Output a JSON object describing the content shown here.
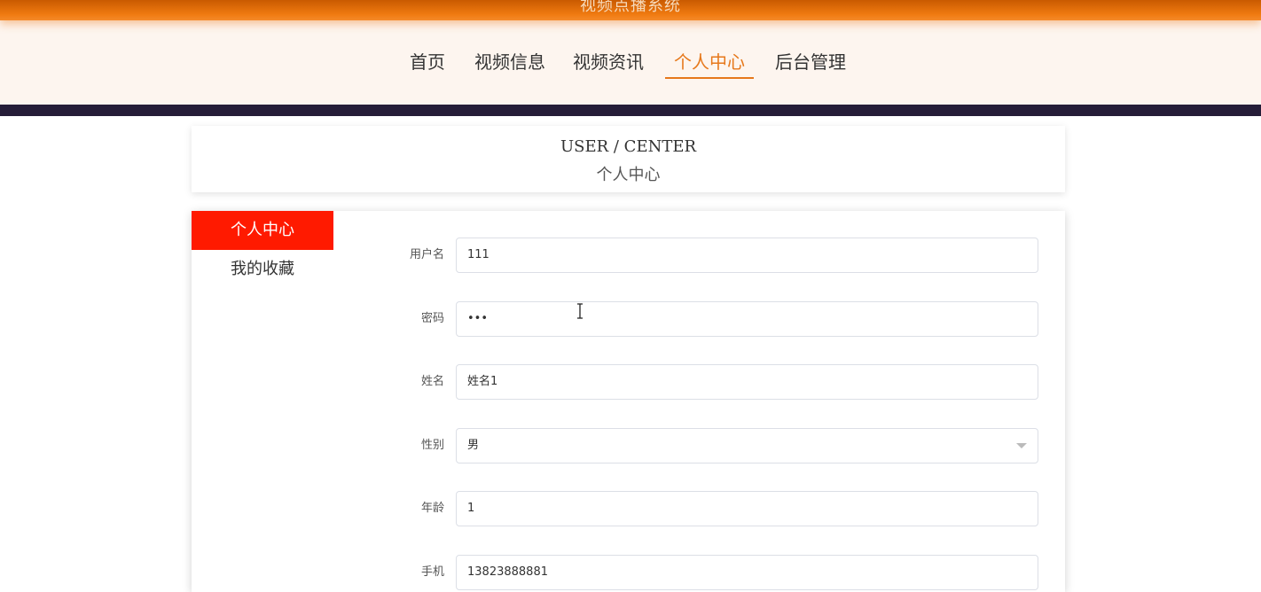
{
  "site": {
    "title": "视频点播系统"
  },
  "nav": {
    "items": [
      {
        "label": "首页",
        "active": false
      },
      {
        "label": "视频信息",
        "active": false
      },
      {
        "label": "视频资讯",
        "active": false
      },
      {
        "label": "个人中心",
        "active": true
      },
      {
        "label": "后台管理",
        "active": false
      }
    ]
  },
  "header": {
    "title_en": "USER / CENTER",
    "title_zh": "个人中心"
  },
  "sidebar": {
    "items": [
      {
        "label": "个人中心",
        "active": true
      },
      {
        "label": "我的收藏",
        "active": false
      }
    ]
  },
  "form": {
    "fields": [
      {
        "label": "用户名",
        "value": "111",
        "type": "text"
      },
      {
        "label": "密码",
        "value": "•••",
        "type": "password"
      },
      {
        "label": "姓名",
        "value": "姓名1",
        "type": "text"
      },
      {
        "label": "性别",
        "value": "男",
        "type": "select"
      },
      {
        "label": "年龄",
        "value": "1",
        "type": "text"
      },
      {
        "label": "手机",
        "value": "13823888881",
        "type": "text"
      }
    ]
  },
  "colors": {
    "accent_orange": "#e6781b",
    "sidebar_active": "#ff1a00",
    "dark_band": "#251d38",
    "nav_bg": "#fdf5ef"
  }
}
